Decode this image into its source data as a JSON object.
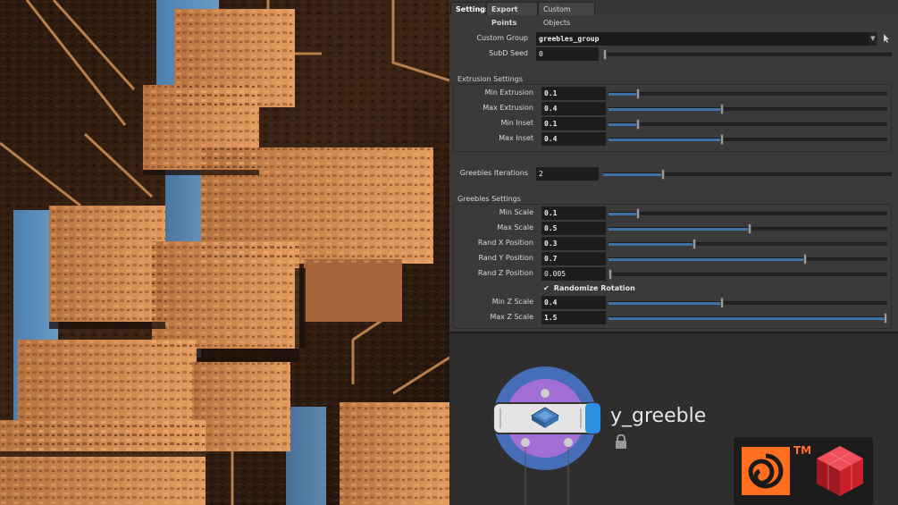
{
  "tabs": [
    {
      "label": "Settings",
      "active": true
    },
    {
      "label": "Export Points",
      "active": false
    },
    {
      "label": "Custom Objects",
      "active": false
    }
  ],
  "top_params": {
    "custom_group": {
      "label": "Custom Group",
      "value": "greebles_group"
    },
    "subd_seed": {
      "label": "SubD Seed",
      "value": "0",
      "fraction": 0.0
    }
  },
  "extrusion_settings": {
    "title": "Extrusion Settings",
    "params": [
      {
        "label": "Min Extrusion",
        "value": "0.1",
        "fraction": 0.1
      },
      {
        "label": "Max Extrusion",
        "value": "0.4",
        "fraction": 0.4
      },
      {
        "label": "Min Inset",
        "value": "0.1",
        "fraction": 0.1
      },
      {
        "label": "Max Inset",
        "value": "0.4",
        "fraction": 0.4
      }
    ]
  },
  "greebles_iterations": {
    "label": "Greebles Iterations",
    "value": "2",
    "fraction": 0.2
  },
  "greebles_settings": {
    "title": "Greebles Settings",
    "params": [
      {
        "label": "Min Scale",
        "value": "0.1",
        "fraction": 0.1
      },
      {
        "label": "Max Scale",
        "value": "0.5",
        "fraction": 0.5
      },
      {
        "label": "Rand X Position",
        "value": "0.3",
        "fraction": 0.3
      },
      {
        "label": "Rand Y Position",
        "value": "0.7",
        "fraction": 0.7
      },
      {
        "label": "Rand Z Position",
        "value": "0.005",
        "fraction": 0.0
      }
    ],
    "randomize_rotation": {
      "label": "Randomize Rotation",
      "checked": true
    },
    "params2": [
      {
        "label": "Min Z Scale",
        "value": "0.4",
        "fraction": 0.4
      },
      {
        "label": "Max Z Scale",
        "value": "1.5",
        "fraction": 1.0
      }
    ]
  },
  "node": {
    "name": "y_greeble"
  },
  "logos": {
    "tm": "TM"
  },
  "colors": {
    "accent": "#3f72a6",
    "node_ring": "#4a78d0",
    "node_inner": "#9b6bd0",
    "node_flag": "#2a8fe0",
    "houdini": "#ff6f1f",
    "redshift": "#e0303a"
  }
}
